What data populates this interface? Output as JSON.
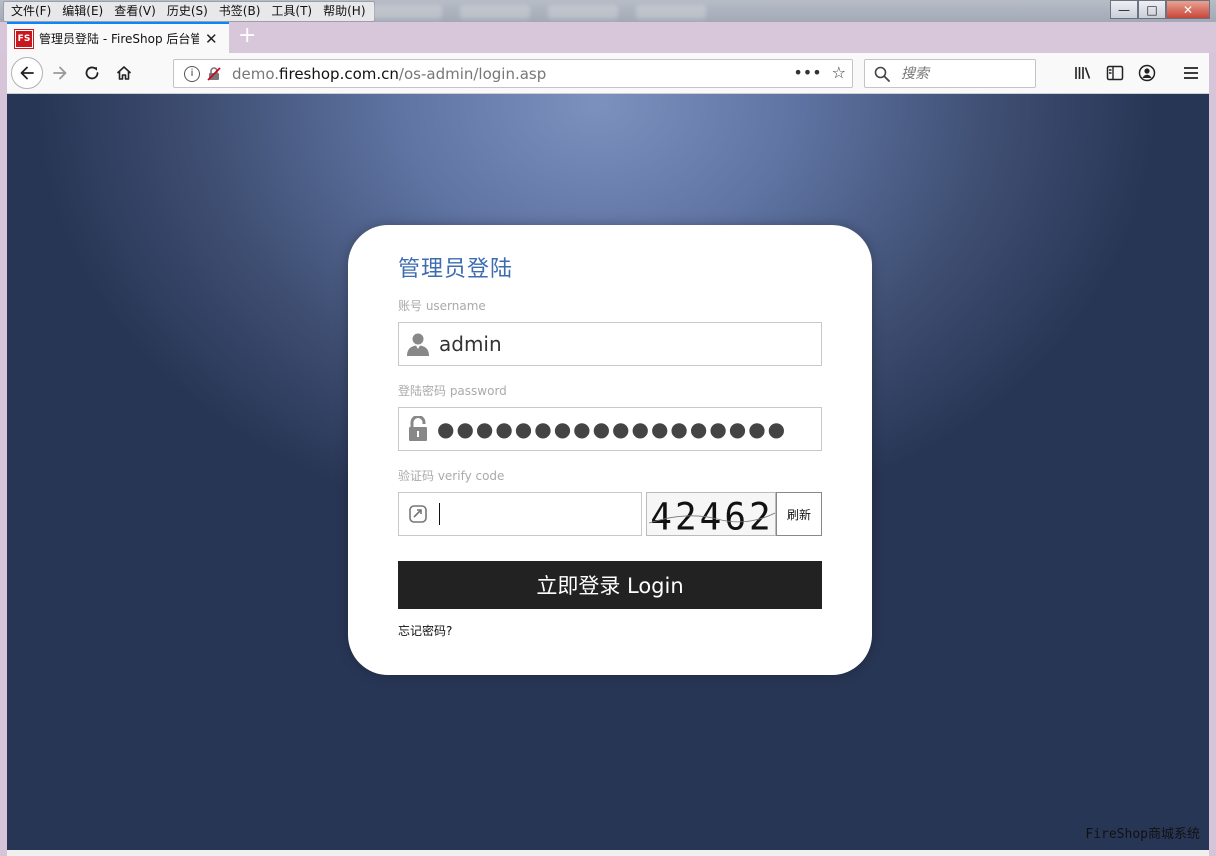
{
  "browser": {
    "menu": [
      "文件(F)",
      "编辑(E)",
      "查看(V)",
      "历史(S)",
      "书签(B)",
      "工具(T)",
      "帮助(H)"
    ],
    "window_controls": {
      "minimize": "—",
      "maximize": "□",
      "close": "✕"
    },
    "tab": {
      "favicon_text": "FS",
      "title": "管理员登陆 - FireShop 后台管",
      "close": "✕"
    },
    "new_tab": "+",
    "url": {
      "prefix": "demo.",
      "domain": "fireshop.com.cn",
      "path": "/os-admin/login.asp"
    },
    "url_actions": {
      "more": "•••",
      "bookmark": "☆"
    },
    "search": {
      "placeholder": "搜索"
    },
    "accent_color": "#0a84ff"
  },
  "login": {
    "title": "管理员登陆",
    "username_label": "账号 username",
    "username_value": "admin",
    "password_label": "登陆密码 password",
    "password_mask": "●●●●●●●●●●●●●●●●●●",
    "verify_label": "验证码 verify code",
    "verify_value": "",
    "captcha_text": "42462",
    "refresh_label": "刷新",
    "submit_label": "立即登录 Login",
    "forgot_label": "忘记密码?"
  },
  "footer": {
    "brand": "FireShop商城系统"
  },
  "colors": {
    "title_blue": "#3d6db0",
    "button_dark": "#222222",
    "brand_red": "#c8181e"
  },
  "icons": {
    "username": "user-icon",
    "password": "lock-icon",
    "verify": "captcha-shield-icon",
    "info": "info-icon",
    "insecure": "insecure-connection-icon",
    "search": "search-icon",
    "library": "library-icon",
    "sidebar": "sidebar-icon",
    "account": "account-icon",
    "menu": "hamburger-menu-icon"
  }
}
